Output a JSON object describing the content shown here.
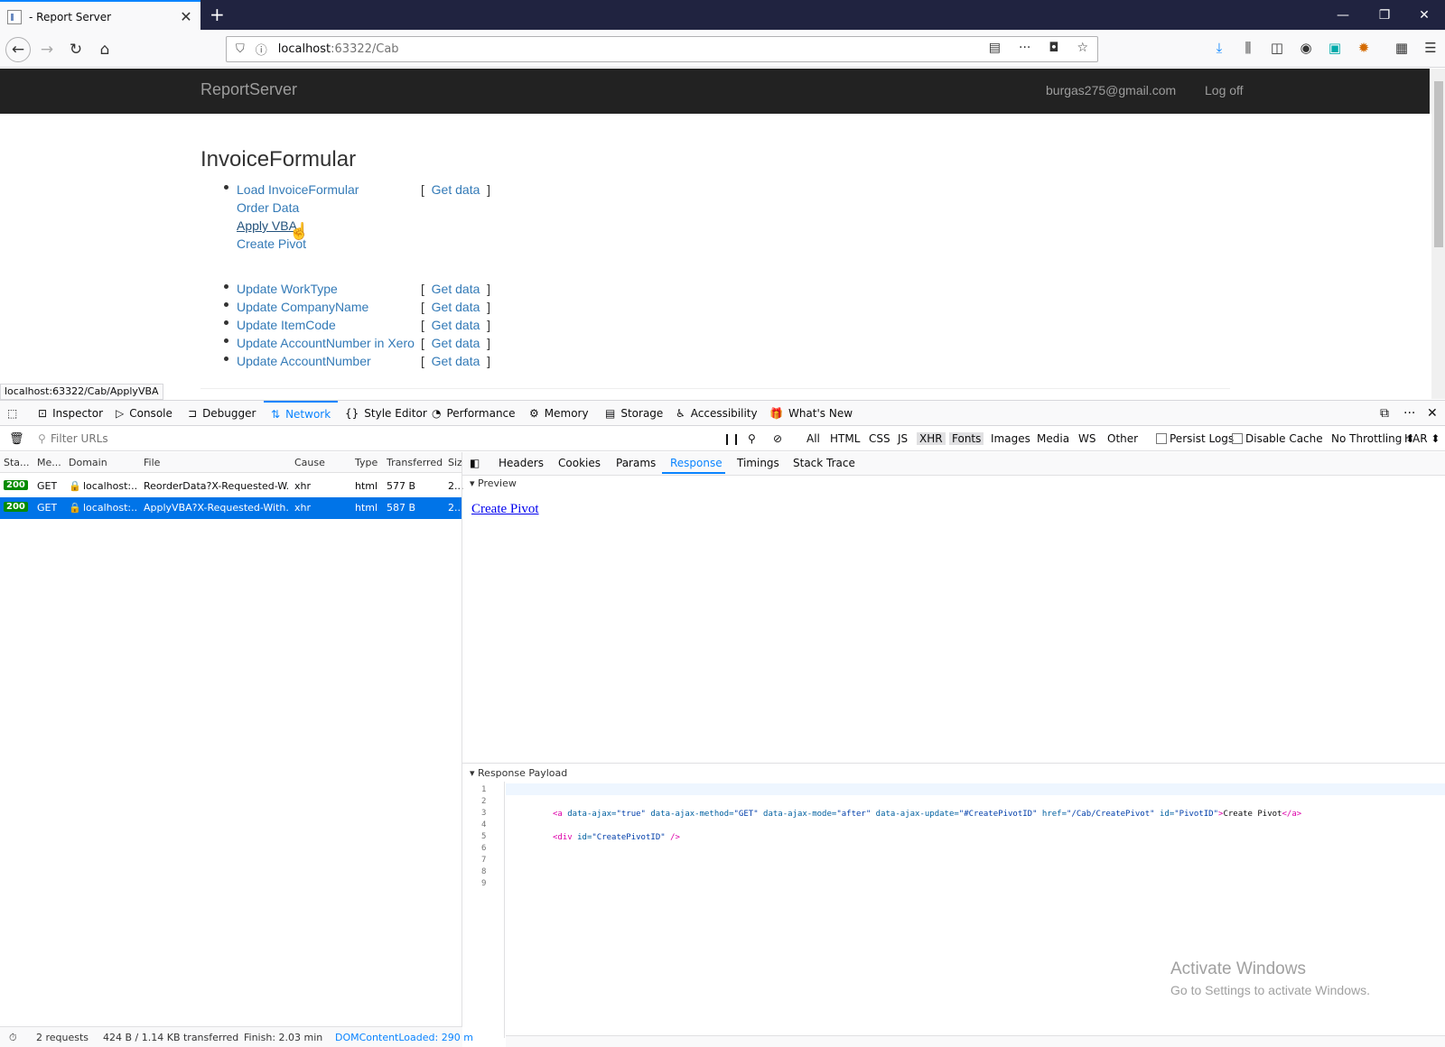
{
  "browser": {
    "tab_title": "- Report Server",
    "url_host": "localhost",
    "url_path": ":63322/Cab",
    "window_buttons": [
      "—",
      "❐",
      "✕"
    ]
  },
  "site": {
    "brand": "ReportServer",
    "user_email": "burgas275@gmail.com",
    "logoff": "Log off",
    "heading": "InvoiceFormular",
    "group1": [
      {
        "label": "Load InvoiceFormular",
        "get": "Get data"
      },
      {
        "label": "Order Data",
        "get": ""
      },
      {
        "label": "Apply VBA",
        "get": ""
      },
      {
        "label": "Create Pivot",
        "get": ""
      }
    ],
    "group2": [
      {
        "label": "Update WorkType",
        "get": "Get data"
      },
      {
        "label": "Update CompanyName",
        "get": "Get data"
      },
      {
        "label": "Update ItemCode",
        "get": "Get data"
      },
      {
        "label": "Update AccountNumber in Xero",
        "get": "Get data"
      },
      {
        "label": "Update AccountNumber",
        "get": "Get data"
      }
    ],
    "status_link": "localhost:63322/Cab/ApplyVBA"
  },
  "devtools": {
    "tabs": [
      "Inspector",
      "Console",
      "Debugger",
      "Network",
      "Style Editor",
      "Performance",
      "Memory",
      "Storage",
      "Accessibility",
      "What's New"
    ],
    "active_tab": "Network",
    "filter_placeholder": "Filter URLs",
    "filters": [
      "All",
      "HTML",
      "CSS",
      "JS",
      "XHR",
      "Fonts",
      "Images",
      "Media",
      "WS",
      "Other"
    ],
    "persist_logs": "Persist Logs",
    "disable_cache": "Disable Cache",
    "throttling": "No Throttling ⬍",
    "har": "HAR ⬍",
    "columns": [
      "Sta...",
      "Me...",
      "Domain",
      "File",
      "Cause",
      "Type",
      "Transferred",
      "Siz"
    ],
    "requests": [
      {
        "status": "200",
        "method": "GET",
        "domain": "localhost:...",
        "file": "ReorderData?X-Requested-W...",
        "cause": "xhr",
        "type": "html",
        "transferred": "577 B",
        "size": "2..."
      },
      {
        "status": "200",
        "method": "GET",
        "domain": "localhost:...",
        "file": "ApplyVBA?X-Requested-With...",
        "cause": "xhr",
        "type": "html",
        "transferred": "587 B",
        "size": "2..."
      }
    ],
    "detail_tabs": [
      "Headers",
      "Cookies",
      "Params",
      "Response",
      "Timings",
      "Stack Trace"
    ],
    "detail_active": "Response",
    "preview_label": "Preview",
    "preview_link": "Create Pivot",
    "payload_label": "Response Payload",
    "line_numbers": [
      "1",
      "2",
      "3",
      "4",
      "5",
      "6",
      "7",
      "8",
      "9"
    ],
    "code_line3": {
      "open": "<a",
      "a1": "data-ajax=",
      "v1": "\"true\"",
      "a2": "data-ajax-method=",
      "v2": "\"GET\"",
      "a3": "data-ajax-mode=",
      "v3": "\"after\"",
      "a4": "data-ajax-update=",
      "v4": "\"#CreatePivotID\"",
      "a5": "href=",
      "v5": "\"/Cab/CreatePivot\"",
      "a6": "id=",
      "v6": "\"PivotID\"",
      "gt": ">",
      "text": "Create Pivot",
      "close": "</a>"
    },
    "code_line5": {
      "open": "<div",
      "a1": "id=",
      "v1": "\"CreatePivotID\"",
      "close": " />"
    },
    "footer": {
      "requests": "2 requests",
      "transferred": "424 B / 1.14 KB transferred",
      "finish": "Finish: 2.03 min",
      "dcl": "DOMContentLoaded: 290 m"
    }
  },
  "watermark": {
    "title": "Activate Windows",
    "subtitle": "Go to Settings to activate Windows."
  }
}
